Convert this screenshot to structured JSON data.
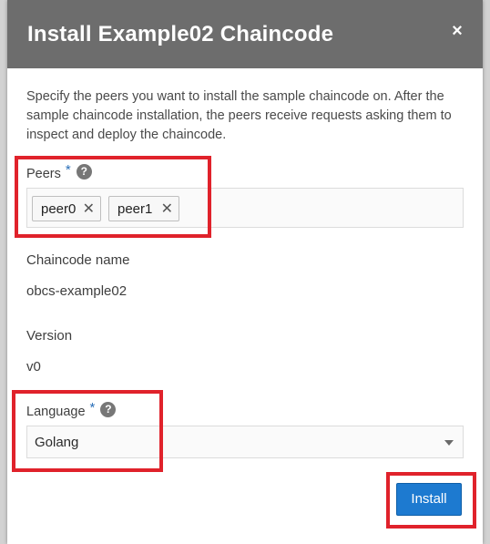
{
  "dialog": {
    "title": "Install Example02 Chaincode",
    "close_glyph": "×",
    "intro_text": "Specify the peers you want to install the sample chaincode on. After the sample chaincode installation, the peers receive requests asking them to inspect and deploy the chaincode.",
    "peers": {
      "label": "Peers",
      "required_mark": "*",
      "help_glyph": "?",
      "chips": [
        {
          "label": "peer0",
          "remove_glyph": "✕"
        },
        {
          "label": "peer1",
          "remove_glyph": "✕"
        }
      ]
    },
    "chaincode_name": {
      "label": "Chaincode name",
      "value": "obcs-example02"
    },
    "version": {
      "label": "Version",
      "value": "v0"
    },
    "language": {
      "label": "Language",
      "required_mark": "*",
      "help_glyph": "?",
      "selected": "Golang"
    },
    "install_label": "Install"
  },
  "colors": {
    "header": "#6d6d6d",
    "primary_button": "#1d7ad0",
    "highlight": "#e0222b",
    "required": "#2a6fb8"
  },
  "icons": {
    "close": "close-icon",
    "help": "help-icon",
    "remove": "remove-chip-icon",
    "dropdown": "chevron-down-icon"
  }
}
